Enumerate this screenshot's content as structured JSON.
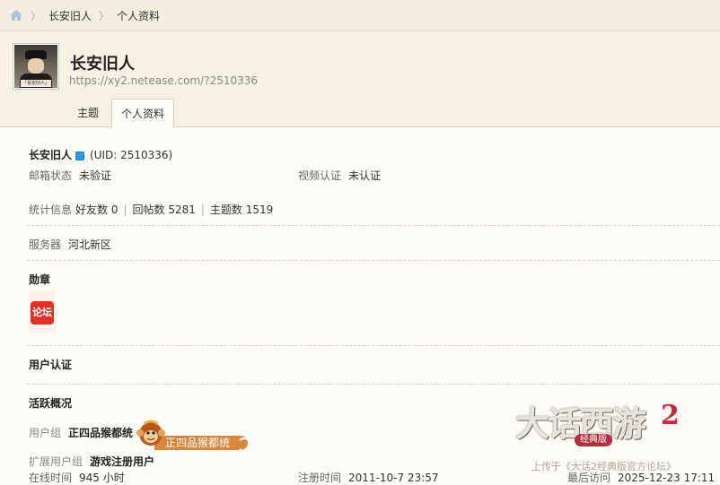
{
  "breadcrumb": {
    "items": [
      "长安旧人",
      "个人资料"
    ]
  },
  "profile": {
    "name": "长安旧人",
    "url": "https://xy2.netease.com/?2510336",
    "avatar_caption": "「長安旧人」"
  },
  "tabs": [
    {
      "label": "主题",
      "active": false
    },
    {
      "label": "个人资料",
      "active": true
    }
  ],
  "info": {
    "name": "长安旧人",
    "uid": "(UID: 2510336)",
    "email_label": "邮箱状态",
    "email_value": "未验证",
    "video_label": "视频认证",
    "video_value": "未认证",
    "stats_label": "统计信息",
    "friends": "好友数 0",
    "replies": "回帖数 5281",
    "topics": "主题数 1519",
    "server_label": "服务器",
    "server_value": "河北新区",
    "medal_heading": "勋章",
    "medal_text": "论坛",
    "auth_heading": "用户认证",
    "activity_heading": "活跃概况",
    "group_label": "用户组",
    "group_value": "正四品猴都统",
    "group_badge": "正四品猴都统",
    "ext_group_label": "扩展用户组",
    "ext_group_value": "游戏注册用户",
    "online_label": "在线时间",
    "online_value": "945 小时",
    "reg_label": "注册时间",
    "reg_value": "2011-10-7 23:57",
    "last_label": "最后访问",
    "last_value": "2025-12-23 17:11"
  },
  "watermark": {
    "logo_text": "大话西游",
    "logo_num": "2",
    "logo_sub": "经典版",
    "caption": "上传于《大话2经典版官方论坛》"
  },
  "colors": {
    "accent_blue": "#2b9ee8",
    "badge_orange": "#d9873b",
    "medal_red": "#e0322a",
    "header_bg": "#f7f1e4"
  }
}
